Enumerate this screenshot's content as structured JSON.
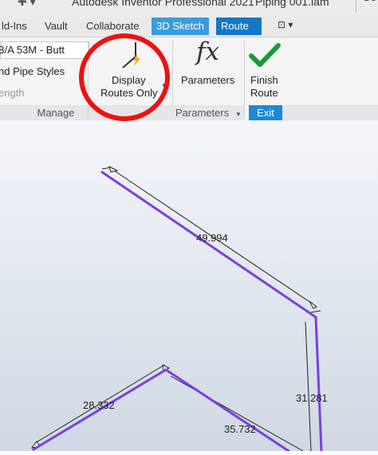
{
  "window": {
    "app_title": "Autodesk Inventor Professional 2021",
    "document": "Piping 001.iam",
    "search_fragment": "Se"
  },
  "tabs": [
    {
      "label": "ld-Ins"
    },
    {
      "label": "Vault"
    },
    {
      "label": "Collaborate"
    },
    {
      "label": "3D Sketch"
    },
    {
      "label": "Route"
    }
  ],
  "ribbon": {
    "manage": {
      "style_value": "B/A 53M - Butt",
      "pipe_styles": "nd Pipe Styles",
      "length": "ength",
      "label": "Manage"
    },
    "display_routes": {
      "line1": "Display",
      "line2": "Routes Only"
    },
    "parameters": {
      "icon_text": "fx",
      "label": "Parameters",
      "panel_label": "Parameters"
    },
    "finish_route": {
      "line1": "Finish",
      "line2": "Route",
      "panel_label": "Exit"
    }
  },
  "dimensions": {
    "d1": "49.994",
    "d2": "28.332",
    "d3": "31.281",
    "d4": "35.732"
  },
  "colors": {
    "route_line": "#7a3fe0",
    "highlight_circle": "#ee1111",
    "finish_check": "#1a9a3a",
    "route_tab": "#1677c5",
    "sketch_tab": "#3c9bdc"
  }
}
